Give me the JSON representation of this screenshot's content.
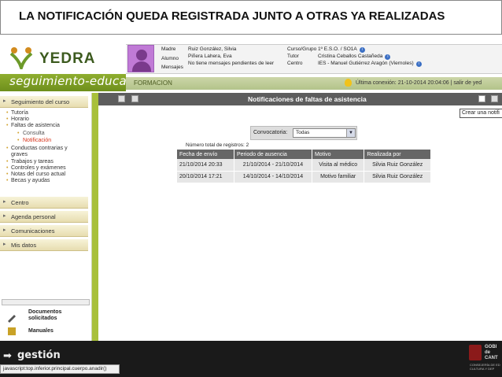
{
  "banner": {
    "text": "LA NOTIFICACIÓN QUEDA REGISTRADA JUNTO A OTRAS YA  REALIZADAS"
  },
  "brand": {
    "name": "YEDRA",
    "tagline": "seguimiento-educativo"
  },
  "user": {
    "roles": [
      "Madre",
      "Alumno",
      "Mensajes"
    ],
    "names": [
      "Ruiz González, Silvia",
      "Piñera Lahera, Eva",
      "No tiene mensajes pendientes de leer"
    ],
    "labels": [
      "Curso/Grupo",
      "Tutor",
      "Centro"
    ],
    "values": [
      "1º E.S.O. / SO1A",
      "Cristina Ceballos Castañeda",
      "IES - Manuel Gutiérrez Aragón (Viernoles)"
    ]
  },
  "formbar": {
    "label": "FORMACION",
    "last_connection": "Última conexión: 21-10-2014 20:04:06 | salir de yed"
  },
  "sidebar": {
    "items": [
      "Seguimiento del curso",
      "Tutoría",
      "Horario",
      "Faltas de asistencia",
      "Consulta",
      "Notificación",
      "Conductas contrarias y",
      "graves",
      "Trabajos y tareas",
      "Controles y exámenes",
      "Notas del curso actual",
      "Becas y ayudas",
      "Centro",
      "Agenda personal",
      "Comunicaciones",
      "Mis datos"
    ],
    "docs_label": "Documentos\nsolicitados",
    "manuals_label": "Manuales"
  },
  "main": {
    "title": "Notificaciones de faltas de asistencia",
    "tooltip": "Crear una notifi",
    "convocatoria_label": "Convocatoria:",
    "convocatoria_value": "Todas",
    "count_text": "Número total de registros: 2",
    "table": {
      "headers": [
        "Fecha de envío",
        "Periodo de ausencia",
        "Motivo",
        "Realizada por"
      ],
      "rows": [
        [
          "21/10/2014 20:33",
          "21/10/2014 - 21/10/2014",
          "Visita al médico",
          "Silvia Ruiz González"
        ],
        [
          "20/10/2014 17:21",
          "14/10/2014 - 14/10/2014",
          "Motivo familiar",
          "Silvia Ruiz González"
        ]
      ]
    }
  },
  "footer": {
    "gestion": "gestión",
    "status": "javascript:top.inferior.principal.cuerpo.anadir()",
    "gob": "GOBI\nde\nCANT",
    "gob_sub": "CONSEJERÍA DE ED\nCULTURA Y DEP"
  }
}
